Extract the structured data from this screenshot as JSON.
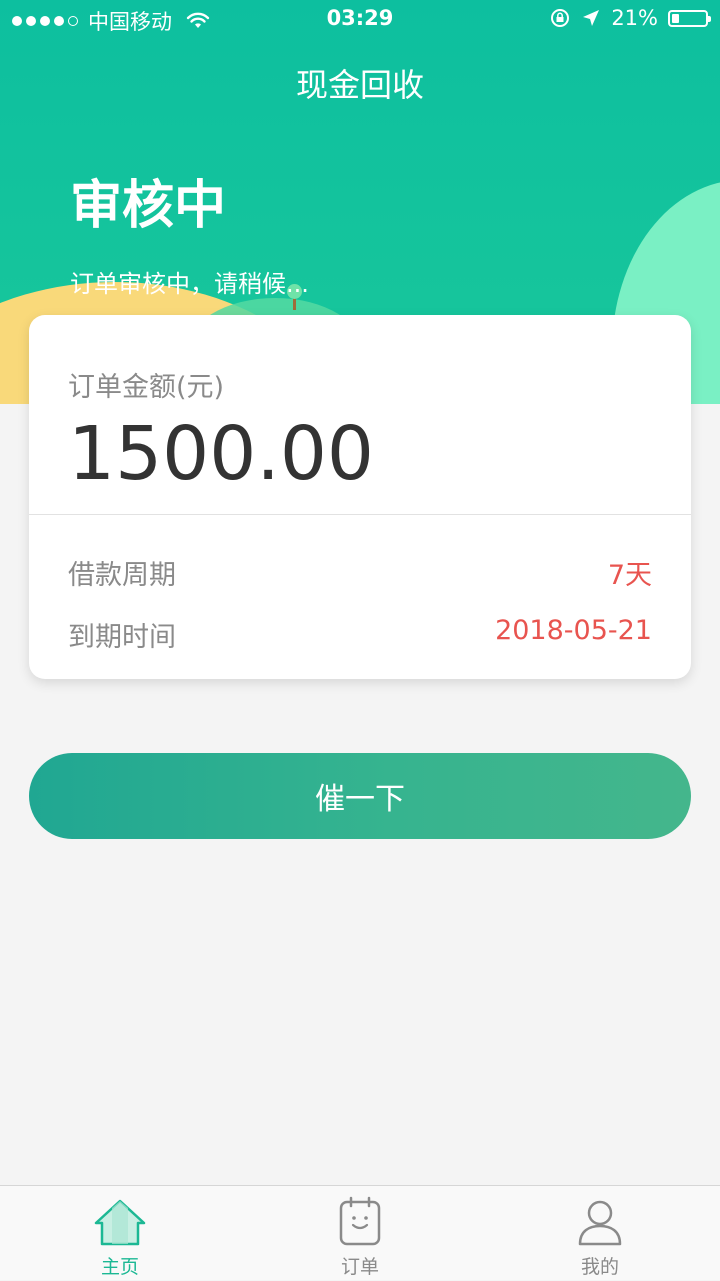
{
  "status_bar": {
    "carrier": "中国移动",
    "time": "03:29",
    "battery": "21%",
    "battery_level": 0.21
  },
  "nav": {
    "title": "现金回收"
  },
  "status": {
    "title": "审核中",
    "subtitle": "订单审核中，请稍候..."
  },
  "order": {
    "amount_label": "订单金额(元)",
    "amount": "1500.00",
    "rows": [
      {
        "label": "借款周期",
        "value": "7天"
      },
      {
        "label": "到期时间",
        "value": "2018-05-21"
      }
    ]
  },
  "actions": {
    "urge_label": "催一下"
  },
  "tabbar": {
    "items": [
      {
        "label": "主页",
        "icon": "home-icon",
        "active": true
      },
      {
        "label": "订单",
        "icon": "order-icon",
        "active": false
      },
      {
        "label": "我的",
        "icon": "profile-icon",
        "active": false
      }
    ]
  },
  "colors": {
    "primary_green": "#0dbf9f",
    "accent_red": "#e8544f",
    "active_tab": "#1cb894"
  }
}
